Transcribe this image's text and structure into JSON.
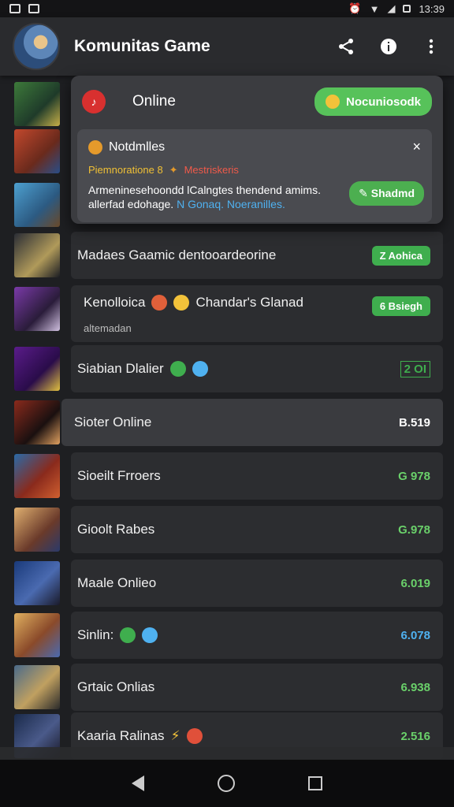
{
  "status_bar": {
    "time": "13:39"
  },
  "app_bar": {
    "title": "Komunitas Game",
    "icons": [
      "share-icon",
      "info-icon",
      "more-vert-icon"
    ]
  },
  "overlay": {
    "status_label": "Online",
    "badge_text": "Nocuniosodk",
    "notification": {
      "title": "Notdmlles",
      "warning_yellow": "Piemnorationе 8",
      "warning_red": "Mestriskeris",
      "body_line1": "Armeninesehoondd lCalngtes thendend amims.",
      "body_line2_plain": "allerfad edohage.",
      "body_line2_blue": "N Gonaq. Noeranilles.",
      "action_label": "Shadmd",
      "close_label": "×"
    }
  },
  "rows": [
    {
      "name": "Madaes Gaamic dentooardeorine",
      "value": "Z Aohica",
      "value_type": "pill"
    },
    {
      "name": "Kenolloica",
      "name2": "Chandar's Glanad",
      "sub": "altemadan",
      "value": "6 Bsiegh",
      "value_type": "pill"
    },
    {
      "name": "Siabian Dlalier",
      "value": "2 OI",
      "value_type": "green-box"
    },
    {
      "name": "Sioter Online",
      "value": "B.519",
      "value_type": "white"
    },
    {
      "name": "Sioeilt Frroers",
      "value": "G 978",
      "value_type": "green"
    },
    {
      "name": "Gioolt Rabes",
      "value": "G.978",
      "value_type": "green"
    },
    {
      "name": "Maale Onlieo",
      "value": "6.019",
      "value_type": "green"
    },
    {
      "name": "Sinlin:",
      "value": "6.078",
      "value_type": "blue"
    },
    {
      "name": "Grtaic Onlias",
      "value": "6.938",
      "value_type": "green"
    },
    {
      "name": "Kaaria Ralinas",
      "value": "2.516",
      "value_type": "green"
    }
  ],
  "colors": {
    "accent_green": "#3fae4e",
    "accent_red": "#d8302f",
    "accent_blue": "#4fb1f0",
    "background": "#1e1f22"
  },
  "nav": {
    "icons": [
      "back-icon",
      "home-icon",
      "recents-icon"
    ]
  }
}
